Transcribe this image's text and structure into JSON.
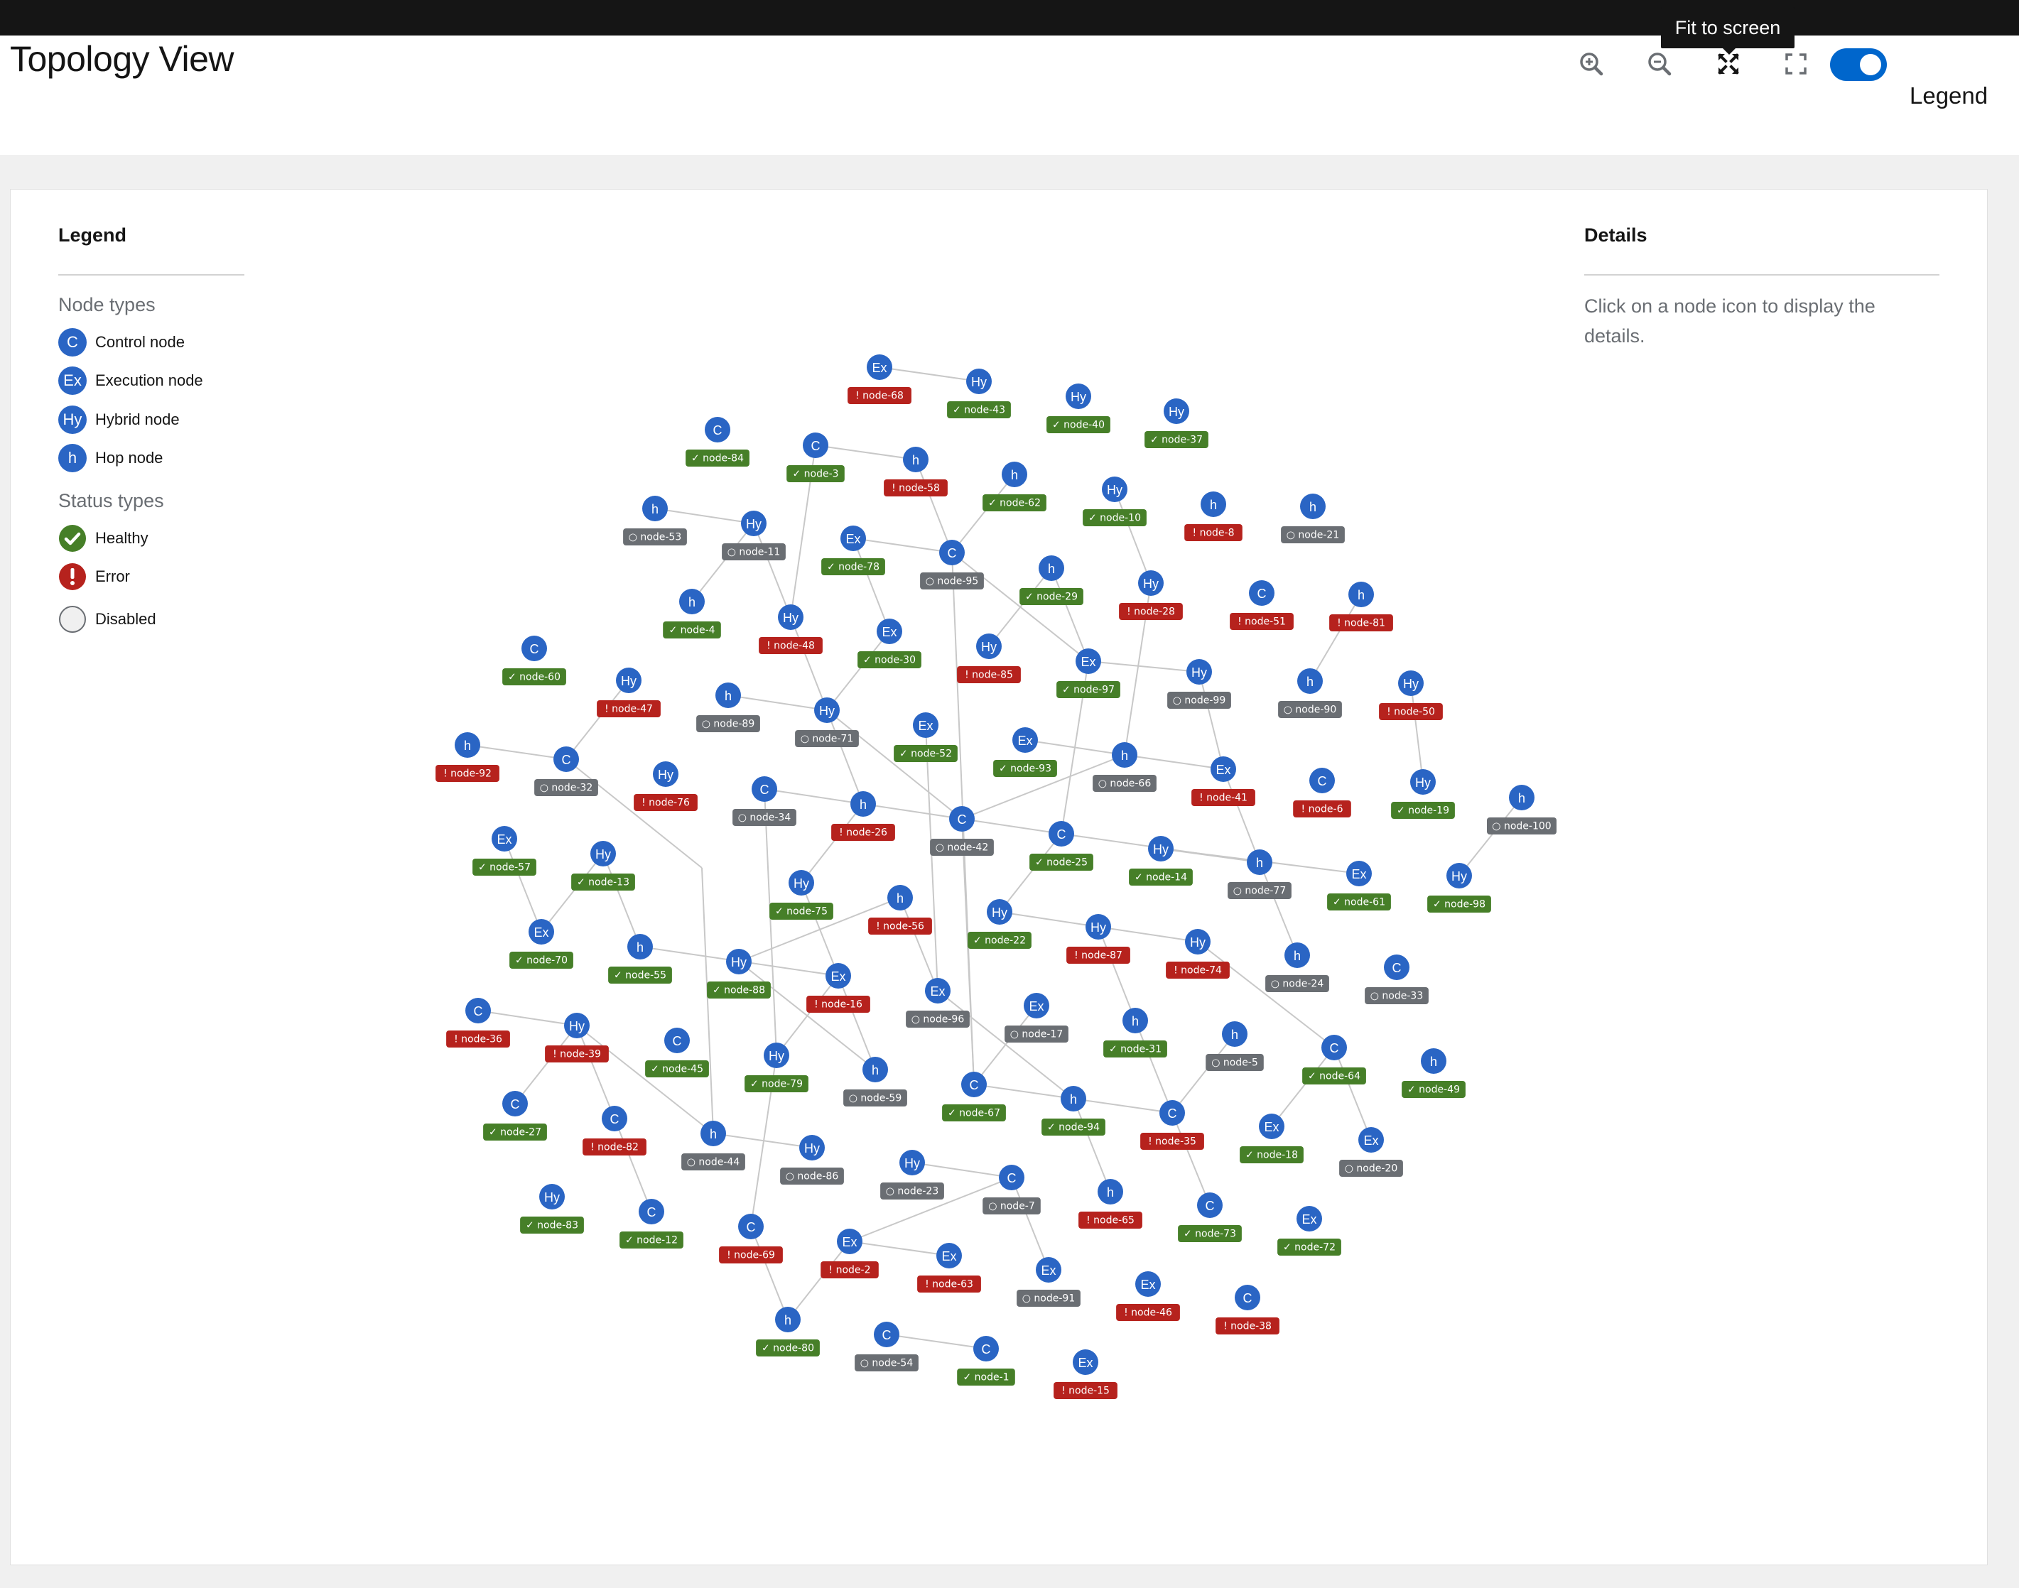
{
  "header": {
    "title": "Topology View",
    "tooltip": "Fit to screen",
    "legend_toggle_label": "Legend",
    "legend_toggle_on": true,
    "toolbar": [
      {
        "name": "zoom-in-icon"
      },
      {
        "name": "zoom-out-icon"
      },
      {
        "name": "fit-to-screen-icon"
      },
      {
        "name": "fullscreen-icon"
      }
    ]
  },
  "legend": {
    "title": "Legend",
    "node_types_title": "Node types",
    "node_types": [
      {
        "abbr": "C",
        "label": "Control node"
      },
      {
        "abbr": "Ex",
        "label": "Execution node"
      },
      {
        "abbr": "Hy",
        "label": "Hybrid node"
      },
      {
        "abbr": "h",
        "label": "Hop node"
      }
    ],
    "status_types_title": "Status types",
    "status_types": [
      {
        "label": "Healthy",
        "icon": "check-circle-icon",
        "color": "#467f28"
      },
      {
        "label": "Error",
        "icon": "exclamation-circle-icon",
        "color": "#b6221d"
      },
      {
        "label": "Disabled",
        "icon": "empty-circle-icon",
        "color": "#6a6e73"
      }
    ]
  },
  "details": {
    "title": "Details",
    "text": "Click on a node icon to display the details."
  },
  "colors": {
    "node": "#2a65c4",
    "healthy": "#467f28",
    "error": "#b6221d",
    "disabled": "#6a6e73",
    "accent": "#0066cc"
  },
  "graph": {
    "nodes": [
      {
        "id": "node-1",
        "type": "C",
        "status": "healthy"
      },
      {
        "id": "node-2",
        "type": "Ex",
        "status": "error"
      },
      {
        "id": "node-3",
        "type": "C",
        "status": "healthy"
      },
      {
        "id": "node-4",
        "type": "h",
        "status": "healthy"
      },
      {
        "id": "node-5",
        "type": "h",
        "status": "disabled"
      },
      {
        "id": "node-6",
        "type": "C",
        "status": "error"
      },
      {
        "id": "node-7",
        "type": "C",
        "status": "disabled"
      },
      {
        "id": "node-8",
        "type": "h",
        "status": "error"
      },
      {
        "id": "node-10",
        "type": "Hy",
        "status": "healthy"
      },
      {
        "id": "node-11",
        "type": "Hy",
        "status": "disabled"
      },
      {
        "id": "node-12",
        "type": "C",
        "status": "healthy"
      },
      {
        "id": "node-13",
        "type": "Hy",
        "status": "healthy"
      },
      {
        "id": "node-14",
        "type": "Hy",
        "status": "healthy"
      },
      {
        "id": "node-15",
        "type": "Ex",
        "status": "error"
      },
      {
        "id": "node-16",
        "type": "Ex",
        "status": "error"
      },
      {
        "id": "node-17",
        "type": "Ex",
        "status": "disabled"
      },
      {
        "id": "node-18",
        "type": "Ex",
        "status": "healthy"
      },
      {
        "id": "node-19",
        "type": "Hy",
        "status": "healthy"
      },
      {
        "id": "node-20",
        "type": "Ex",
        "status": "disabled"
      },
      {
        "id": "node-21",
        "type": "h",
        "status": "disabled"
      },
      {
        "id": "node-22",
        "type": "Hy",
        "status": "healthy"
      },
      {
        "id": "node-23",
        "type": "Hy",
        "status": "disabled"
      },
      {
        "id": "node-24",
        "type": "h",
        "status": "disabled"
      },
      {
        "id": "node-25",
        "type": "C",
        "status": "healthy"
      },
      {
        "id": "node-26",
        "type": "h",
        "status": "error"
      },
      {
        "id": "node-27",
        "type": "C",
        "status": "healthy"
      },
      {
        "id": "node-28",
        "type": "Hy",
        "status": "error"
      },
      {
        "id": "node-29",
        "type": "h",
        "status": "healthy"
      },
      {
        "id": "node-30",
        "type": "Ex",
        "status": "healthy"
      },
      {
        "id": "node-31",
        "type": "h",
        "status": "healthy"
      },
      {
        "id": "node-32",
        "type": "C",
        "status": "disabled"
      },
      {
        "id": "node-33",
        "type": "C",
        "status": "disabled"
      },
      {
        "id": "node-34",
        "type": "C",
        "status": "disabled"
      },
      {
        "id": "node-35",
        "type": "C",
        "status": "error"
      },
      {
        "id": "node-36",
        "type": "C",
        "status": "error"
      },
      {
        "id": "node-37",
        "type": "Hy",
        "status": "healthy"
      },
      {
        "id": "node-38",
        "type": "C",
        "status": "error"
      },
      {
        "id": "node-39",
        "type": "Hy",
        "status": "error"
      },
      {
        "id": "node-40",
        "type": "Hy",
        "status": "healthy"
      },
      {
        "id": "node-41",
        "type": "Ex",
        "status": "error"
      },
      {
        "id": "node-42",
        "type": "C",
        "status": "disabled"
      },
      {
        "id": "node-43",
        "type": "Hy",
        "status": "healthy"
      },
      {
        "id": "node-44",
        "type": "h",
        "status": "disabled"
      },
      {
        "id": "node-45",
        "type": "C",
        "status": "healthy"
      },
      {
        "id": "node-46",
        "type": "Ex",
        "status": "error"
      },
      {
        "id": "node-47",
        "type": "Hy",
        "status": "error"
      },
      {
        "id": "node-48",
        "type": "Hy",
        "status": "error"
      },
      {
        "id": "node-49",
        "type": "h",
        "status": "healthy"
      },
      {
        "id": "node-50",
        "type": "Hy",
        "status": "error"
      },
      {
        "id": "node-51",
        "type": "C",
        "status": "error"
      },
      {
        "id": "node-52",
        "type": "Ex",
        "status": "healthy"
      },
      {
        "id": "node-53",
        "type": "h",
        "status": "disabled"
      },
      {
        "id": "node-54",
        "type": "C",
        "status": "disabled"
      },
      {
        "id": "node-55",
        "type": "h",
        "status": "healthy"
      },
      {
        "id": "node-56",
        "type": "h",
        "status": "error"
      },
      {
        "id": "node-57",
        "type": "Ex",
        "status": "healthy"
      },
      {
        "id": "node-58",
        "type": "h",
        "status": "error"
      },
      {
        "id": "node-59",
        "type": "h",
        "status": "disabled"
      },
      {
        "id": "node-60",
        "type": "C",
        "status": "healthy"
      },
      {
        "id": "node-61",
        "type": "Ex",
        "status": "healthy"
      },
      {
        "id": "node-62",
        "type": "h",
        "status": "healthy"
      },
      {
        "id": "node-63",
        "type": "Ex",
        "status": "error"
      },
      {
        "id": "node-64",
        "type": "C",
        "status": "healthy"
      },
      {
        "id": "node-65",
        "type": "h",
        "status": "error"
      },
      {
        "id": "node-66",
        "type": "h",
        "status": "disabled"
      },
      {
        "id": "node-67",
        "type": "C",
        "status": "healthy"
      },
      {
        "id": "node-68",
        "type": "Ex",
        "status": "error"
      },
      {
        "id": "node-69",
        "type": "C",
        "status": "error"
      },
      {
        "id": "node-70",
        "type": "Ex",
        "status": "healthy"
      },
      {
        "id": "node-71",
        "type": "Hy",
        "status": "disabled"
      },
      {
        "id": "node-72",
        "type": "Ex",
        "status": "healthy"
      },
      {
        "id": "node-73",
        "type": "C",
        "status": "healthy"
      },
      {
        "id": "node-74",
        "type": "Hy",
        "status": "error"
      },
      {
        "id": "node-75",
        "type": "Hy",
        "status": "healthy"
      },
      {
        "id": "node-76",
        "type": "Hy",
        "status": "error"
      },
      {
        "id": "node-77",
        "type": "h",
        "status": "disabled"
      },
      {
        "id": "node-78",
        "type": "Ex",
        "status": "healthy"
      },
      {
        "id": "node-79",
        "type": "Hy",
        "status": "healthy"
      },
      {
        "id": "node-80",
        "type": "h",
        "status": "healthy"
      },
      {
        "id": "node-81",
        "type": "h",
        "status": "error"
      },
      {
        "id": "node-82",
        "type": "C",
        "status": "error"
      },
      {
        "id": "node-83",
        "type": "Hy",
        "status": "healthy"
      },
      {
        "id": "node-84",
        "type": "C",
        "status": "healthy"
      },
      {
        "id": "node-85",
        "type": "Hy",
        "status": "error"
      },
      {
        "id": "node-86",
        "type": "Hy",
        "status": "disabled"
      },
      {
        "id": "node-87",
        "type": "Hy",
        "status": "error"
      },
      {
        "id": "node-88",
        "type": "Hy",
        "status": "healthy"
      },
      {
        "id": "node-89",
        "type": "h",
        "status": "disabled"
      },
      {
        "id": "node-90",
        "type": "h",
        "status": "disabled"
      },
      {
        "id": "node-91",
        "type": "Ex",
        "status": "disabled"
      },
      {
        "id": "node-92",
        "type": "h",
        "status": "error"
      },
      {
        "id": "node-93",
        "type": "Ex",
        "status": "healthy"
      },
      {
        "id": "node-94",
        "type": "h",
        "status": "healthy"
      },
      {
        "id": "node-95",
        "type": "C",
        "status": "disabled"
      },
      {
        "id": "node-96",
        "type": "Ex",
        "status": "disabled"
      },
      {
        "id": "node-97",
        "type": "Ex",
        "status": "healthy"
      },
      {
        "id": "node-98",
        "type": "Hy",
        "status": "healthy"
      },
      {
        "id": "node-99",
        "type": "Hy",
        "status": "disabled"
      },
      {
        "id": "node-100",
        "type": "h",
        "status": "disabled"
      }
    ],
    "edges": [
      [
        "node-68",
        "node-43"
      ],
      [
        "node-3",
        "node-58"
      ],
      [
        "node-3",
        "node-48"
      ],
      [
        "node-58",
        "node-95"
      ],
      [
        "node-62",
        "node-95"
      ],
      [
        "node-53",
        "node-11"
      ],
      [
        "node-11",
        "node-4"
      ],
      [
        "node-11",
        "node-48"
      ],
      [
        "node-78",
        "node-95"
      ],
      [
        "node-78",
        "node-30"
      ],
      [
        "node-95",
        "node-97"
      ],
      [
        "node-95",
        "node-67"
      ],
      [
        "node-29",
        "node-85"
      ],
      [
        "node-29",
        "node-97"
      ],
      [
        "node-10",
        "node-28"
      ],
      [
        "node-28",
        "node-66"
      ],
      [
        "node-81",
        "node-90"
      ],
      [
        "node-97",
        "node-99"
      ],
      [
        "node-97",
        "node-25"
      ],
      [
        "node-99",
        "node-41"
      ],
      [
        "node-48",
        "node-71"
      ],
      [
        "node-30",
        "node-71"
      ],
      [
        "node-89",
        "node-71"
      ],
      [
        "node-71",
        "node-42"
      ],
      [
        "node-71",
        "node-26"
      ],
      [
        "node-47",
        "node-32"
      ],
      [
        "node-92",
        "node-32"
      ],
      [
        "node-32",
        "node-9"
      ],
      [
        "node-50",
        "node-19"
      ],
      [
        "node-52",
        "node-96"
      ],
      [
        "node-93",
        "node-66"
      ],
      [
        "node-66",
        "node-41"
      ],
      [
        "node-66",
        "node-42"
      ],
      [
        "node-41",
        "node-77"
      ],
      [
        "node-100",
        "node-98"
      ],
      [
        "node-34",
        "node-42"
      ],
      [
        "node-34",
        "node-79"
      ],
      [
        "node-26",
        "node-75"
      ],
      [
        "node-42",
        "node-25"
      ],
      [
        "node-42",
        "node-67"
      ],
      [
        "node-25",
        "node-77"
      ],
      [
        "node-25",
        "node-22"
      ],
      [
        "node-14",
        "node-77"
      ],
      [
        "node-14",
        "node-61"
      ],
      [
        "node-77",
        "node-24"
      ],
      [
        "node-57",
        "node-70"
      ],
      [
        "node-13",
        "node-70"
      ],
      [
        "node-13",
        "node-55"
      ],
      [
        "node-9",
        "node-44"
      ],
      [
        "node-75",
        "node-16"
      ],
      [
        "node-56",
        "node-96"
      ],
      [
        "node-56",
        "node-88"
      ],
      [
        "node-22",
        "node-87"
      ],
      [
        "node-87",
        "node-74"
      ],
      [
        "node-87",
        "node-31"
      ],
      [
        "node-74",
        "node-64"
      ],
      [
        "node-55",
        "node-16"
      ],
      [
        "node-88",
        "node-59"
      ],
      [
        "node-16",
        "node-59"
      ],
      [
        "node-16",
        "node-79"
      ],
      [
        "node-96",
        "node-94"
      ],
      [
        "node-17",
        "node-67"
      ],
      [
        "node-31",
        "node-35"
      ],
      [
        "node-5",
        "node-35"
      ],
      [
        "node-64",
        "node-18"
      ],
      [
        "node-64",
        "node-20"
      ],
      [
        "node-39",
        "node-27"
      ],
      [
        "node-39",
        "node-82"
      ],
      [
        "node-39",
        "node-44"
      ],
      [
        "node-82",
        "node-12"
      ],
      [
        "node-44",
        "node-86"
      ],
      [
        "node-79",
        "node-69"
      ],
      [
        "node-67",
        "node-94"
      ],
      [
        "node-94",
        "node-35"
      ],
      [
        "node-94",
        "node-65"
      ],
      [
        "node-35",
        "node-73"
      ],
      [
        "node-23",
        "node-7"
      ],
      [
        "node-7",
        "node-2"
      ],
      [
        "node-7",
        "node-91"
      ],
      [
        "node-2",
        "node-63"
      ],
      [
        "node-2",
        "node-80"
      ],
      [
        "node-69",
        "node-80"
      ],
      [
        "node-54",
        "node-1"
      ],
      [
        "node-36",
        "node-39"
      ]
    ]
  }
}
